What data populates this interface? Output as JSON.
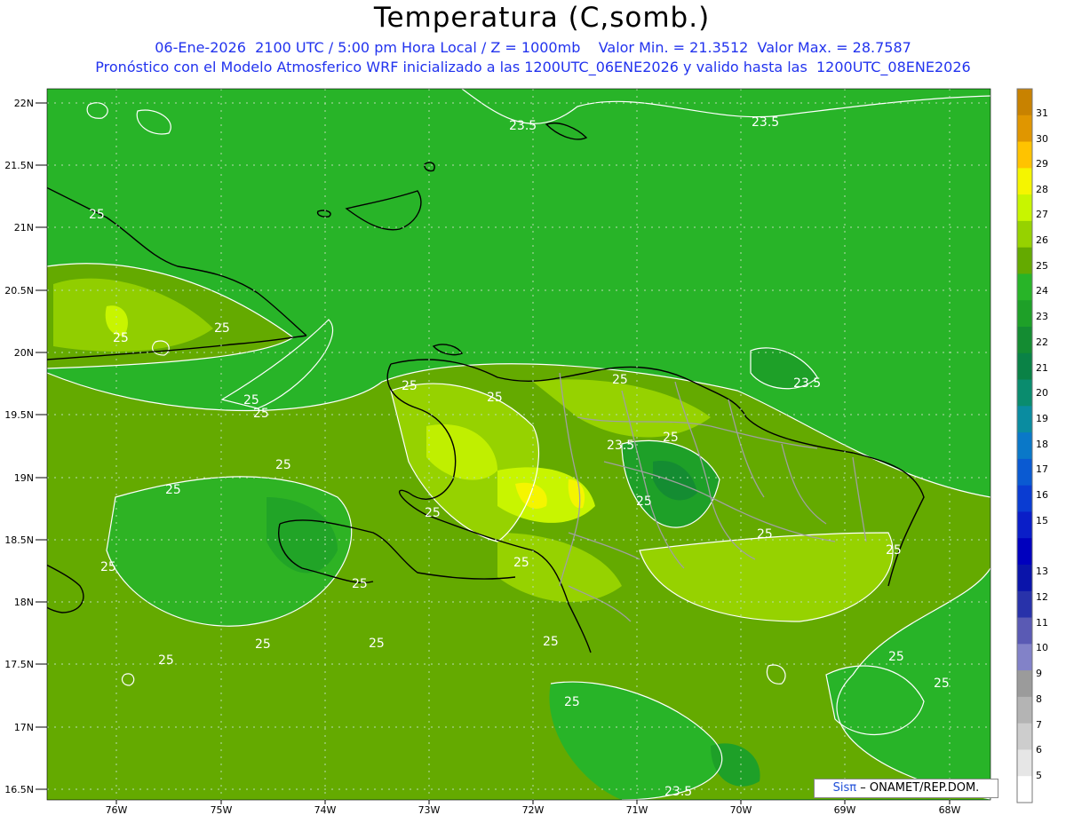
{
  "title": "Temperatura (C,somb.)",
  "subtitle_line1": "06-Ene-2026  2100 UTC / 5:00 pm Hora Local / Z = 1000mb    Valor Min. = 21.3512  Valor Max. = 28.7587",
  "subtitle_line2": "Pronóstico con el Modelo Atmosferico WRF inicializado a las 1200UTC_06ENE2026 y valido hasta las  1200UTC_08ENE2026",
  "credit": {
    "logo": "Sisπ",
    "text": "– ONAMET/REP.DOM."
  },
  "map": {
    "lat_labels": [
      "22N",
      "21.5N",
      "21N",
      "20.5N",
      "20N",
      "19.5N",
      "19N",
      "18.5N",
      "18N",
      "17.5N",
      "17N",
      "16.5N"
    ],
    "lon_labels": [
      "76W",
      "75W",
      "74W",
      "73W",
      "72W",
      "71W",
      "70W",
      "69W",
      "68W"
    ],
    "contour_labels": [
      "23.5",
      "23.5",
      "25",
      "25",
      "25",
      "25",
      "25",
      "25",
      "25",
      "25",
      "23.5",
      "25",
      "23.5",
      "25",
      "25",
      "25",
      "25",
      "25",
      "25",
      "25",
      "25",
      "25",
      "25",
      "25",
      "25",
      "25",
      "25",
      "25",
      "25",
      "23.5"
    ]
  },
  "colorbar": {
    "labels": [
      "31",
      "30",
      "29",
      "28",
      "27",
      "26",
      "25",
      "24",
      "23",
      "22",
      "21",
      "20",
      "19",
      "18",
      "17",
      "16",
      "15",
      "13",
      "12",
      "11",
      "10",
      "9",
      "8",
      "7",
      "6",
      "5"
    ],
    "colors": [
      "#c88200",
      "#e09600",
      "#ffc300",
      "#f5f500",
      "#c8f500",
      "#96d200",
      "#64aa00",
      "#28b428",
      "#1ea028",
      "#148c32",
      "#0a8246",
      "#0a8c6e",
      "#0a8ca0",
      "#0a78c8",
      "#0a5ad2",
      "#0a3cd2",
      "#0a1ec8",
      "#0000be",
      "#0a14aa",
      "#2832aa",
      "#5a5ab4",
      "#8282c8",
      "#9b9b9b",
      "#b4b4b4",
      "#cdcdcd",
      "#e6e6e6",
      "#ffffff"
    ]
  }
}
